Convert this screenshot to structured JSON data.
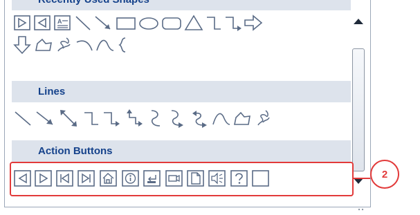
{
  "sections": {
    "recent": "Recently Used Shapes",
    "lines": "Lines",
    "action_buttons": "Action Buttons"
  },
  "callout": {
    "number": "2"
  },
  "colors": {
    "header_text": "#15428b",
    "header_bg": "#dde3ec",
    "highlight": "#e23a3a"
  },
  "shapes": {
    "recent_row1": [
      "action-forward-icon",
      "action-back-icon",
      "text-box-icon",
      "line-icon",
      "arrow-icon",
      "rectangle-icon",
      "oval-icon",
      "rounded-rectangle-icon",
      "triangle-icon",
      "elbow-connector-icon",
      "elbow-arrow-connector-icon",
      "right-arrow-icon"
    ],
    "recent_row2": [
      "down-arrow-icon",
      "freeform-icon",
      "scribble-icon",
      "arc-icon",
      "curve-icon",
      "left-brace-icon"
    ],
    "lines": [
      "line-icon",
      "arrow-icon",
      "double-arrow-icon",
      "elbow-connector-icon",
      "elbow-arrow-connector-icon",
      "elbow-double-arrow-connector-icon",
      "curved-connector-icon",
      "curved-arrow-connector-icon",
      "curved-double-arrow-connector-icon",
      "curve-icon",
      "freeform-icon",
      "scribble-icon"
    ],
    "action_buttons": [
      "back-or-previous-button-icon",
      "forward-or-next-button-icon",
      "beginning-button-icon",
      "end-button-icon",
      "home-button-icon",
      "information-button-icon",
      "return-button-icon",
      "movie-button-icon",
      "document-button-icon",
      "sound-button-icon",
      "help-button-icon",
      "custom-button-icon"
    ]
  }
}
